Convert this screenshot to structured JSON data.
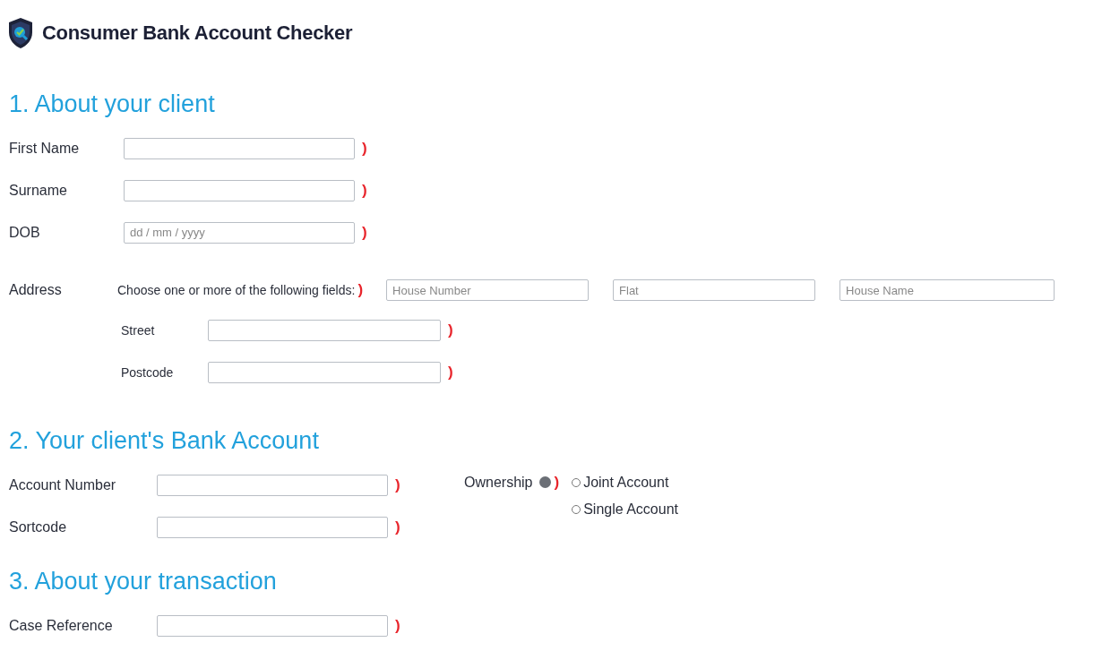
{
  "app": {
    "title": "Consumer Bank Account Checker"
  },
  "client": {
    "heading": "1. About your client",
    "fields": [
      {
        "label": "First Name",
        "required_mark": ")"
      },
      {
        "label": "Surname",
        "required_mark": ")"
      },
      {
        "label": "DOB",
        "placeholder": "dd / mm / yyyy",
        "required_mark": ")"
      }
    ],
    "address": {
      "label": "Address",
      "instruction": "Choose one or more of the following fields:",
      "required_mark": ")",
      "options": [
        {
          "placeholder": "House Number"
        },
        {
          "placeholder": "Flat"
        },
        {
          "placeholder": "House Name"
        }
      ],
      "fields": [
        {
          "label": "Street",
          "required_mark": ")"
        },
        {
          "label": "Postcode",
          "required_mark": ")"
        }
      ]
    }
  },
  "bank_account": {
    "heading": "2. Your client's Bank Account",
    "fields": [
      {
        "label": "Account Number",
        "required_mark": ")"
      },
      {
        "label": "Sortcode",
        "required_mark": ")"
      }
    ],
    "ownership": {
      "label": "Ownership",
      "required_mark": ")",
      "options": [
        {
          "label": "Joint Account",
          "selected": false
        },
        {
          "label": "Single Account",
          "selected": false
        }
      ]
    }
  },
  "transaction": {
    "heading": "3. About your transaction",
    "fields": [
      {
        "label": "Case Reference",
        "required_mark": ")"
      }
    ]
  }
}
